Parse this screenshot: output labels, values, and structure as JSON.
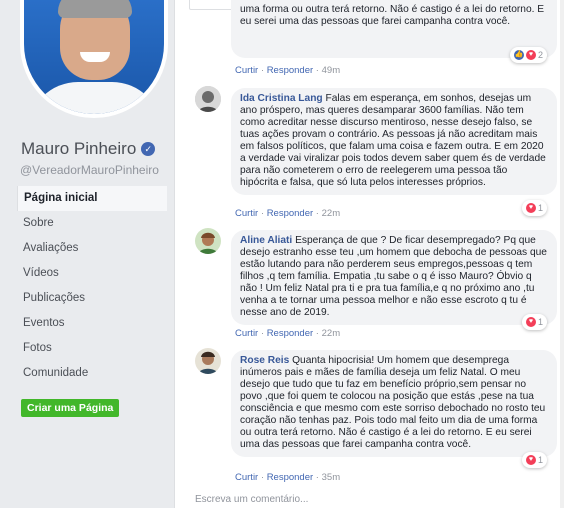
{
  "page": {
    "name": "Mauro Pinheiro",
    "handle": "@VereadorMauroPinheiro",
    "nav": [
      "Página inicial",
      "Sobre",
      "Avaliações",
      "Vídeos",
      "Publicações",
      "Eventos",
      "Fotos",
      "Comunidade"
    ],
    "create_page": "Criar uma Página"
  },
  "comments": [
    {
      "author": "",
      "text": "uma forma ou outra terá retorno. Não é castigo é a lei do retorno. E eu serei uma das pessoas que farei campanha contra você.",
      "like": "Curtir",
      "reply": "Responder",
      "time": "49m",
      "reactions": "2"
    },
    {
      "author": "Ida Cristina Lang",
      "text": "Falas em esperança, em sonhos, desejas um ano próspero, mas queres desamparar 3600 famílias. Não tem como acreditar nesse discurso mentiroso, nesse desejo falso, se tuas ações provam o contrário. As pessoas já não acreditam mais em falsos políticos, que falam uma coisa e fazem outra. E em 2020 a verdade vai viralizar pois todos devem saber quem és de verdade para não cometerem o erro de reelegerem uma pessoa tão hipócrita e falsa, que só luta pelos interesses próprios.",
      "like": "Curtir",
      "reply": "Responder",
      "time": "22m",
      "reactions": "1"
    },
    {
      "author": "Aline Aliati",
      "text": "Esperança de que ? De ficar desempregado? Pq que desejo estranho esse teu ,um homem que debocha de pessoas que estão lutando para não perderem seus empregos,pessoas q tem filhos ,q tem família. Empatia ,tu sabe o q é isso Mauro? Óbvio q não ! Um feliz Natal pra ti e pra tua família,e q no próximo ano ,tu venha a te tornar uma pessoa melhor e não esse escroto q tu é nesse ano de 2019.",
      "like": "Curtir",
      "reply": "Responder",
      "time": "22m",
      "reactions": "1"
    },
    {
      "author": "Rose Reis",
      "text": "Quanta hipocrisia! Um homem que desemprega inúmeros pais e mães de família deseja um feliz Natal. O meu desejo que tudo que tu faz em benefício próprio,sem pensar no povo ,que foi quem te colocou na posição que estás ,pese na tua consciência e que mesmo com este sorriso debochado no rosto teu coração não tenhas paz. Pois todo mal feito um dia de uma forma ou outra terá retorno. Não é castigo é a lei do retorno. E eu serei uma das pessoas que farei campanha contra você.",
      "like": "Curtir",
      "reply": "Responder",
      "time": "35m",
      "reactions": "1"
    }
  ],
  "write_comment": "Escreva um comentário...",
  "colors": {
    "link": "#385898",
    "accent": "#4267b2",
    "green": "#42b72a",
    "heart": "#f33e58"
  }
}
